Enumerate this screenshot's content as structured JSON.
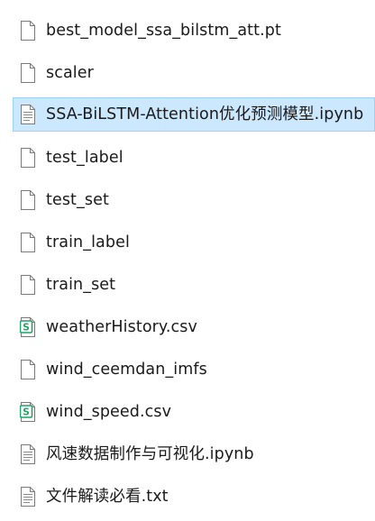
{
  "files": [
    {
      "name": "best_model_ssa_bilstm_att.pt",
      "icon": "file-icon",
      "selected": false
    },
    {
      "name": "scaler",
      "icon": "file-icon",
      "selected": false
    },
    {
      "name": "SSA-BiLSTM-Attention优化预测模型.ipynb",
      "icon": "text-file-icon",
      "selected": true
    },
    {
      "name": "test_label",
      "icon": "file-icon",
      "selected": false
    },
    {
      "name": "test_set",
      "icon": "file-icon",
      "selected": false
    },
    {
      "name": "train_label",
      "icon": "file-icon",
      "selected": false
    },
    {
      "name": "train_set",
      "icon": "file-icon",
      "selected": false
    },
    {
      "name": "weatherHistory.csv",
      "icon": "spreadsheet-icon",
      "selected": false
    },
    {
      "name": "wind_ceemdan_imfs",
      "icon": "file-icon",
      "selected": false
    },
    {
      "name": "wind_speed.csv",
      "icon": "spreadsheet-icon",
      "selected": false
    },
    {
      "name": "风速数据制作与可视化.ipynb",
      "icon": "text-file-icon",
      "selected": false
    },
    {
      "name": "文件解读必看.txt",
      "icon": "text-file-icon",
      "selected": false
    }
  ],
  "colors": {
    "selection_background": "#cce8ff",
    "selection_border": "#99d1ff",
    "spreadsheet_icon_green": "#21a366"
  }
}
